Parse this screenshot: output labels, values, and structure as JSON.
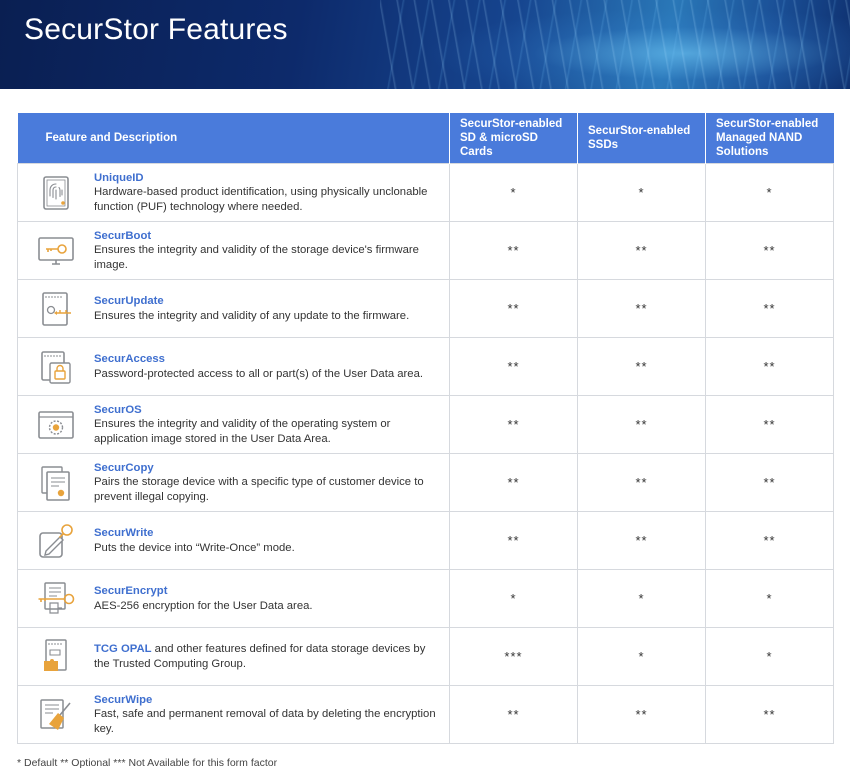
{
  "page": {
    "title": "SecurStor Features",
    "footnote": "* Default ** Optional *** Not Available for this form factor"
  },
  "colors": {
    "header_blue": "#4a7bdb",
    "link_blue": "#3f6fcf",
    "icon_orange": "#e8a33c",
    "icon_gray": "#8a8d92",
    "banner_navy": "#0d2a6b"
  },
  "table": {
    "headers": [
      "Feature and Description",
      "SecurStor-enabled SD & microSD Cards",
      "SecurStor-enabled SSDs",
      "SecurStor-enabled Managed NAND Solutions"
    ],
    "rows": [
      {
        "icon": "fingerprint-icon",
        "name": "UniqueID",
        "description": "Hardware-based product identification, using physically unclonable function (PUF) technology where needed.",
        "sd": "*",
        "ssd": "*",
        "nand": "*"
      },
      {
        "icon": "monitor-key-icon",
        "name": "SecurBoot",
        "description": "Ensures the integrity and validity of the storage device's firmware image.",
        "sd": "**",
        "ssd": "**",
        "nand": "**"
      },
      {
        "icon": "firmware-update-icon",
        "name": "SecurUpdate",
        "description": "Ensures the integrity and validity of any update to the firmware.",
        "sd": "**",
        "ssd": "**",
        "nand": "**"
      },
      {
        "icon": "lock-document-icon",
        "name": "SecurAccess",
        "description": "Password-protected access to all or part(s) of the User Data area.",
        "sd": "**",
        "ssd": "**",
        "nand": "**"
      },
      {
        "icon": "os-gear-icon",
        "name": "SecurOS",
        "description": "Ensures the integrity and validity of the operating system or application image stored in the User Data Area.",
        "sd": "**",
        "ssd": "**",
        "nand": "**"
      },
      {
        "icon": "copy-document-icon",
        "name": "SecurCopy",
        "description": "Pairs the storage device with a specific type of customer device to prevent illegal copying.",
        "sd": "**",
        "ssd": "**",
        "nand": "**"
      },
      {
        "icon": "write-pen-icon",
        "name": "SecurWrite",
        "description": "Puts the device into “Write-Once” mode.",
        "sd": "**",
        "ssd": "**",
        "nand": "**"
      },
      {
        "icon": "encrypt-key-icon",
        "name": "SecurEncrypt",
        "description": "AES-256 encryption for the User Data area.",
        "sd": "*",
        "ssd": "*",
        "nand": "*"
      },
      {
        "icon": "opal-puzzle-icon",
        "name": "TCG OPAL",
        "description": " and other features defined for data storage devices by the Trusted Computing Group.",
        "sd": "***",
        "ssd": "*",
        "nand": "*"
      },
      {
        "icon": "wipe-broom-icon",
        "name": "SecurWipe",
        "description": "Fast, safe and permanent removal of data by deleting the encryption key.",
        "sd": "**",
        "ssd": "**",
        "nand": "**"
      }
    ]
  }
}
